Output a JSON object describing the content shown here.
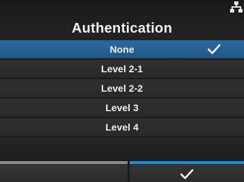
{
  "header": {
    "title": "Authentication",
    "status_icon": "network-icon"
  },
  "list": {
    "items": [
      {
        "label": "None",
        "selected": true
      },
      {
        "label": "Level 2-1",
        "selected": false
      },
      {
        "label": "Level 2-2",
        "selected": false
      },
      {
        "label": "Level 3",
        "selected": false
      },
      {
        "label": "Level 4",
        "selected": false
      }
    ],
    "selected_icon": "checkmark-icon"
  },
  "footer": {
    "left_key_icon": "",
    "right_key_icon": "checkmark-icon"
  },
  "colors": {
    "selected_row": "#2c6aa3",
    "accent_right_key": "#1e8fe0",
    "accent_left_key": "#8a8a8a",
    "row_background": "#2f2f2f",
    "text": "#f0f0f0"
  }
}
